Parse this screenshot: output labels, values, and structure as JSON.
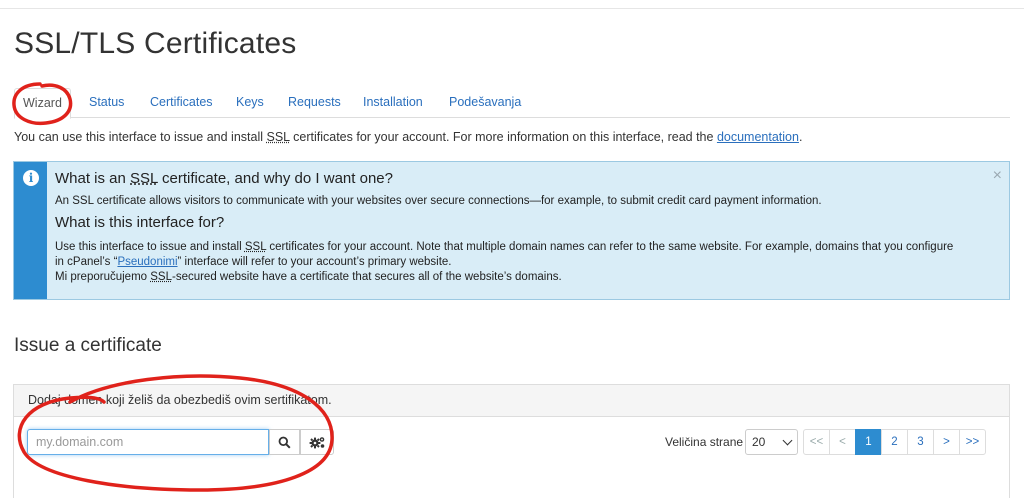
{
  "page": {
    "title": "SSL/TLS Certificates"
  },
  "tabs": [
    {
      "label": "Wizard",
      "active": true
    },
    {
      "label": "Status"
    },
    {
      "label": "Certificates"
    },
    {
      "label": "Keys"
    },
    {
      "label": "Requests"
    },
    {
      "label": "Installation"
    },
    {
      "label": "Podešavanja"
    }
  ],
  "intro": {
    "text_before": "You can use this interface to issue and install ",
    "abbr": "SSL",
    "text_after": " certificates for your account. For more information on this interface, read the ",
    "link": "documentation",
    "end": "."
  },
  "alert": {
    "icon": "info-icon",
    "close": "×",
    "h1_before": "What is an ",
    "h1_abbr": "SSL",
    "h1_after": " certificate, and why do I want one?",
    "p1": "An SSL certificate allows visitors to communicate with your websites over secure connections—for example, to submit credit card payment information.",
    "h2": "What is this interface for?",
    "p2_a": "Use this interface to issue and install ",
    "p2_abbr": "SSL",
    "p2_b": " certificates for your account. Note that multiple domain names can refer to the same website. For example, domains that you configure",
    "p2_c": "in cPanel’s “",
    "p2_link": "Pseudonimi",
    "p2_d": "” interface will refer to your account’s primary website.",
    "p3_a": "Mi preporučujemo ",
    "p3_abbr": "SSL",
    "p3_b": "-secured website have a certificate that secures all of the website’s domains."
  },
  "issue": {
    "title": "Issue a certificate",
    "panel_heading": "Dodaj domen koji želiš da obezbediš ovim sertifikatom.",
    "search_placeholder": "my.domain.com",
    "per_page_label": "Veličina strane",
    "per_page_value": "20",
    "pager": [
      "<<",
      "<",
      "1",
      "2",
      "3",
      ">",
      ">>"
    ],
    "current_page": "1"
  },
  "colors": {
    "accent": "#2d8cd0",
    "link": "#2a6fbd",
    "alert_bg": "#d9edf7",
    "annotation": "#e0221b"
  }
}
